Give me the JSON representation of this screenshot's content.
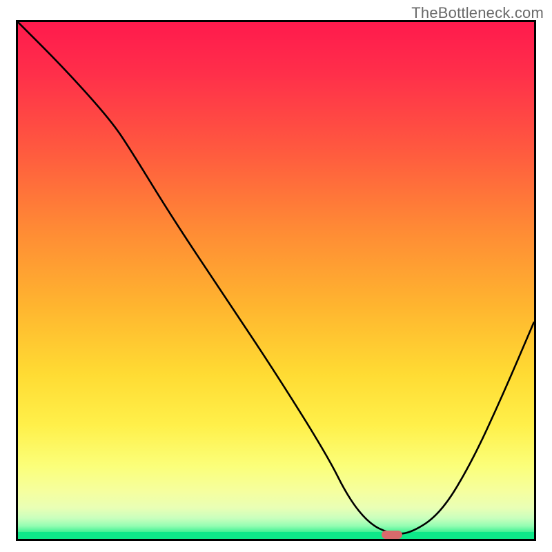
{
  "watermark": "TheBottleneck.com",
  "chart_data": {
    "type": "line",
    "title": "",
    "xlabel": "",
    "ylabel": "",
    "xlim": [
      0,
      100
    ],
    "ylim": [
      0,
      100
    ],
    "grid": false,
    "series": [
      {
        "name": "curve",
        "x": [
          0,
          9,
          18,
          22,
          30,
          40,
          50,
          60,
          64,
          68,
          72,
          76,
          82,
          88,
          94,
          100
        ],
        "y": [
          100,
          91,
          81,
          75,
          62,
          47,
          32,
          16,
          8,
          3,
          1,
          1,
          5,
          15,
          28,
          42
        ]
      }
    ],
    "markers": [
      {
        "name": "min-pill",
        "x": 72.5,
        "y": 0.8,
        "color": "#d86a6c"
      }
    ],
    "background_gradient": {
      "top": "#ff1a4d",
      "mid1": "#ff8a35",
      "mid2": "#ffdb33",
      "pale": "#fbff7a",
      "band": "#0de889"
    }
  }
}
